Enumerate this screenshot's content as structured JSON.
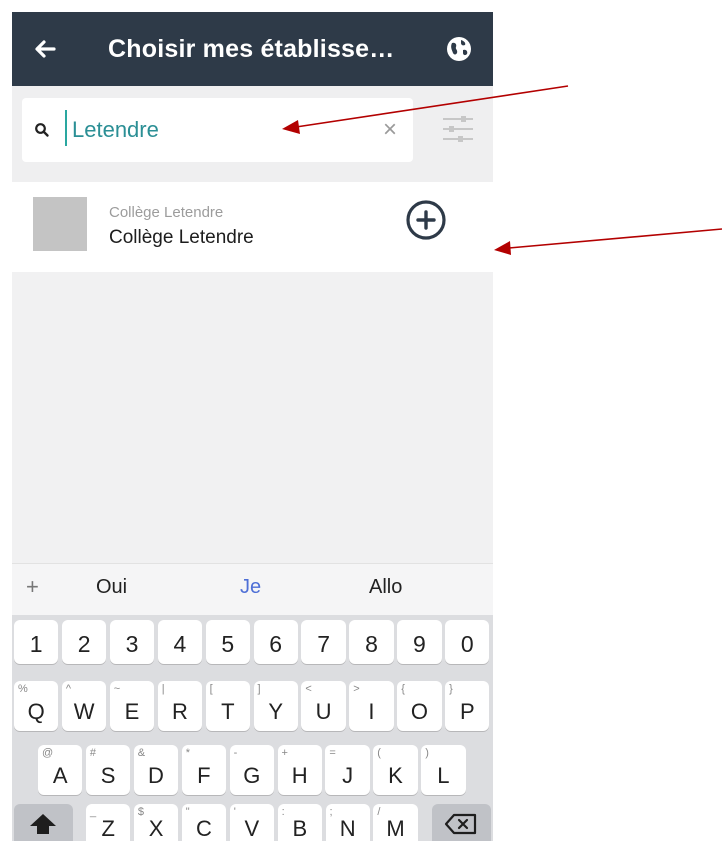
{
  "colors": {
    "appbar": "#2e3a48",
    "accent_teal": "#2b8f95",
    "suggest_highlight": "#4e6fd6",
    "annotation_arrow": "#b30000"
  },
  "appbar": {
    "title": "Choisir mes établisse…",
    "back_icon": "arrow-left-icon",
    "globe_icon": "globe-icon"
  },
  "search": {
    "value": "Letendre",
    "search_icon": "search-icon",
    "clear_label": "×",
    "filter_icon": "sliders-icon"
  },
  "results": [
    {
      "subtitle": "Collège Letendre",
      "name": "Collège Letendre",
      "action_icon": "add-circle-icon"
    }
  ],
  "suggestions": {
    "plus": "+",
    "items": [
      "Oui",
      "Je",
      "Allo"
    ],
    "highlighted": "Je"
  },
  "keyboard": {
    "numbers": [
      "1",
      "2",
      "3",
      "4",
      "5",
      "6",
      "7",
      "8",
      "9",
      "0"
    ],
    "row1": [
      {
        "main": "Q",
        "sub": "%"
      },
      {
        "main": "W",
        "sub": "^"
      },
      {
        "main": "E",
        "sub": "~"
      },
      {
        "main": "R",
        "sub": "|"
      },
      {
        "main": "T",
        "sub": "["
      },
      {
        "main": "Y",
        "sub": "]"
      },
      {
        "main": "U",
        "sub": "<"
      },
      {
        "main": "I",
        "sub": ">"
      },
      {
        "main": "O",
        "sub": "{"
      },
      {
        "main": "P",
        "sub": "}"
      }
    ],
    "row2": [
      {
        "main": "A",
        "sub": "@"
      },
      {
        "main": "S",
        "sub": "#"
      },
      {
        "main": "D",
        "sub": "&"
      },
      {
        "main": "F",
        "sub": "*"
      },
      {
        "main": "G",
        "sub": "-"
      },
      {
        "main": "H",
        "sub": "+"
      },
      {
        "main": "J",
        "sub": "="
      },
      {
        "main": "K",
        "sub": "("
      },
      {
        "main": "L",
        "sub": ")"
      }
    ],
    "row3": [
      {
        "main": "Z",
        "sub": "_"
      },
      {
        "main": "X",
        "sub": "$"
      },
      {
        "main": "C",
        "sub": "\""
      },
      {
        "main": "V",
        "sub": "'"
      },
      {
        "main": "B",
        "sub": ":"
      },
      {
        "main": "N",
        "sub": ";"
      },
      {
        "main": "M",
        "sub": "/"
      }
    ],
    "shift_icon": "shift-icon",
    "backspace_icon": "backspace-icon"
  }
}
